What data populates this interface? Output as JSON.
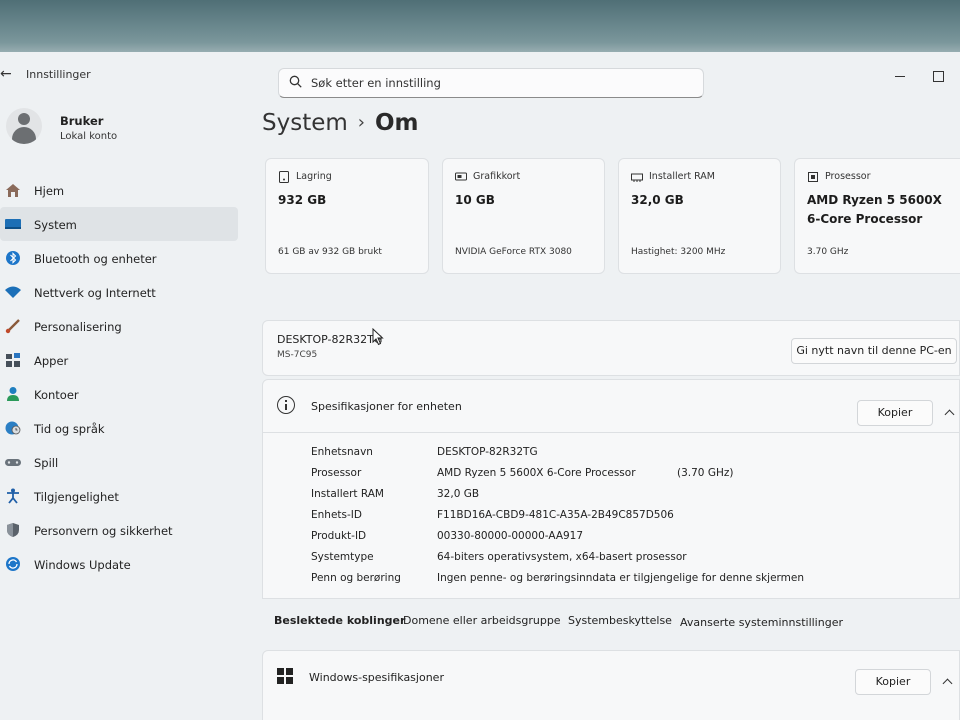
{
  "app": {
    "title": "Innstillinger"
  },
  "search": {
    "placeholder": "Søk etter en innstilling"
  },
  "user": {
    "name": "Bruker",
    "account_type": "Lokal konto"
  },
  "sidebar": {
    "items": [
      {
        "label": "Hjem",
        "icon": "home-icon",
        "active": false
      },
      {
        "label": "System",
        "icon": "system-icon",
        "active": true
      },
      {
        "label": "Bluetooth og enheter",
        "icon": "bluetooth-icon",
        "active": false
      },
      {
        "label": "Nettverk og Internett",
        "icon": "wifi-icon",
        "active": false
      },
      {
        "label": "Personalisering",
        "icon": "brush-icon",
        "active": false
      },
      {
        "label": "Apper",
        "icon": "apps-icon",
        "active": false
      },
      {
        "label": "Kontoer",
        "icon": "person-icon",
        "active": false
      },
      {
        "label": "Tid og språk",
        "icon": "globe-clock-icon",
        "active": false
      },
      {
        "label": "Spill",
        "icon": "gamepad-icon",
        "active": false
      },
      {
        "label": "Tilgjengelighet",
        "icon": "accessibility-icon",
        "active": false
      },
      {
        "label": "Personvern og sikkerhet",
        "icon": "shield-icon",
        "active": false
      },
      {
        "label": "Windows Update",
        "icon": "update-icon",
        "active": false
      }
    ]
  },
  "breadcrumb": {
    "parent": "System",
    "separator": "›",
    "current": "Om"
  },
  "cards": [
    {
      "title": "Lagring",
      "icon": "storage-icon",
      "value": "932 GB",
      "sub": "61 GB av 932 GB brukt"
    },
    {
      "title": "Grafikkort",
      "icon": "gpu-icon",
      "value": "10 GB",
      "sub": "NVIDIA GeForce RTX 3080"
    },
    {
      "title": "Installert RAM",
      "icon": "ram-icon",
      "value": "32,0 GB",
      "sub": "Hastighet: 3200 MHz"
    },
    {
      "title": "Prosessor",
      "icon": "cpu-icon",
      "value": "AMD Ryzen 5 5600X\n6-Core Processor",
      "sub": "3.70 GHz"
    }
  ],
  "device": {
    "name": "DESKTOP-82R32TG",
    "model": "MS-7C95",
    "rename_label": "Gi nytt navn til denne PC-en"
  },
  "specs": {
    "title": "Spesifikasjoner for enheten",
    "copy_label": "Kopier",
    "rows": [
      {
        "key": "Enhetsnavn",
        "value": "DESKTOP-82R32TG",
        "extra": ""
      },
      {
        "key": "Prosessor",
        "value": "AMD Ryzen 5 5600X 6-Core Processor",
        "extra": "(3.70 GHz)"
      },
      {
        "key": "Installert RAM",
        "value": "32,0 GB",
        "extra": ""
      },
      {
        "key": "Enhets-ID",
        "value": "F11BD16A-CBD9-481C-A35A-2B49C857D506",
        "extra": ""
      },
      {
        "key": "Produkt-ID",
        "value": "00330-80000-00000-AA917",
        "extra": ""
      },
      {
        "key": "Systemtype",
        "value": "64-biters operativsystem, x64-basert prosessor",
        "extra": ""
      },
      {
        "key": "Penn og berøring",
        "value": "Ingen penne- og berøringsinndata er tilgjengelige for denne skjermen",
        "extra": ""
      }
    ]
  },
  "related": {
    "heading": "Beslektede koblinger",
    "links": [
      "Domene eller arbeidsgruppe",
      "Systembeskyttelse",
      "Avanserte systeminnstillinger"
    ]
  },
  "winspecs": {
    "title": "Windows-spesifikasjoner",
    "copy_label": "Kopier"
  },
  "colors": {
    "accent": "#0067c0",
    "sidebar_active": "#dfe3e6",
    "card_bg": "#f7f8f9"
  }
}
